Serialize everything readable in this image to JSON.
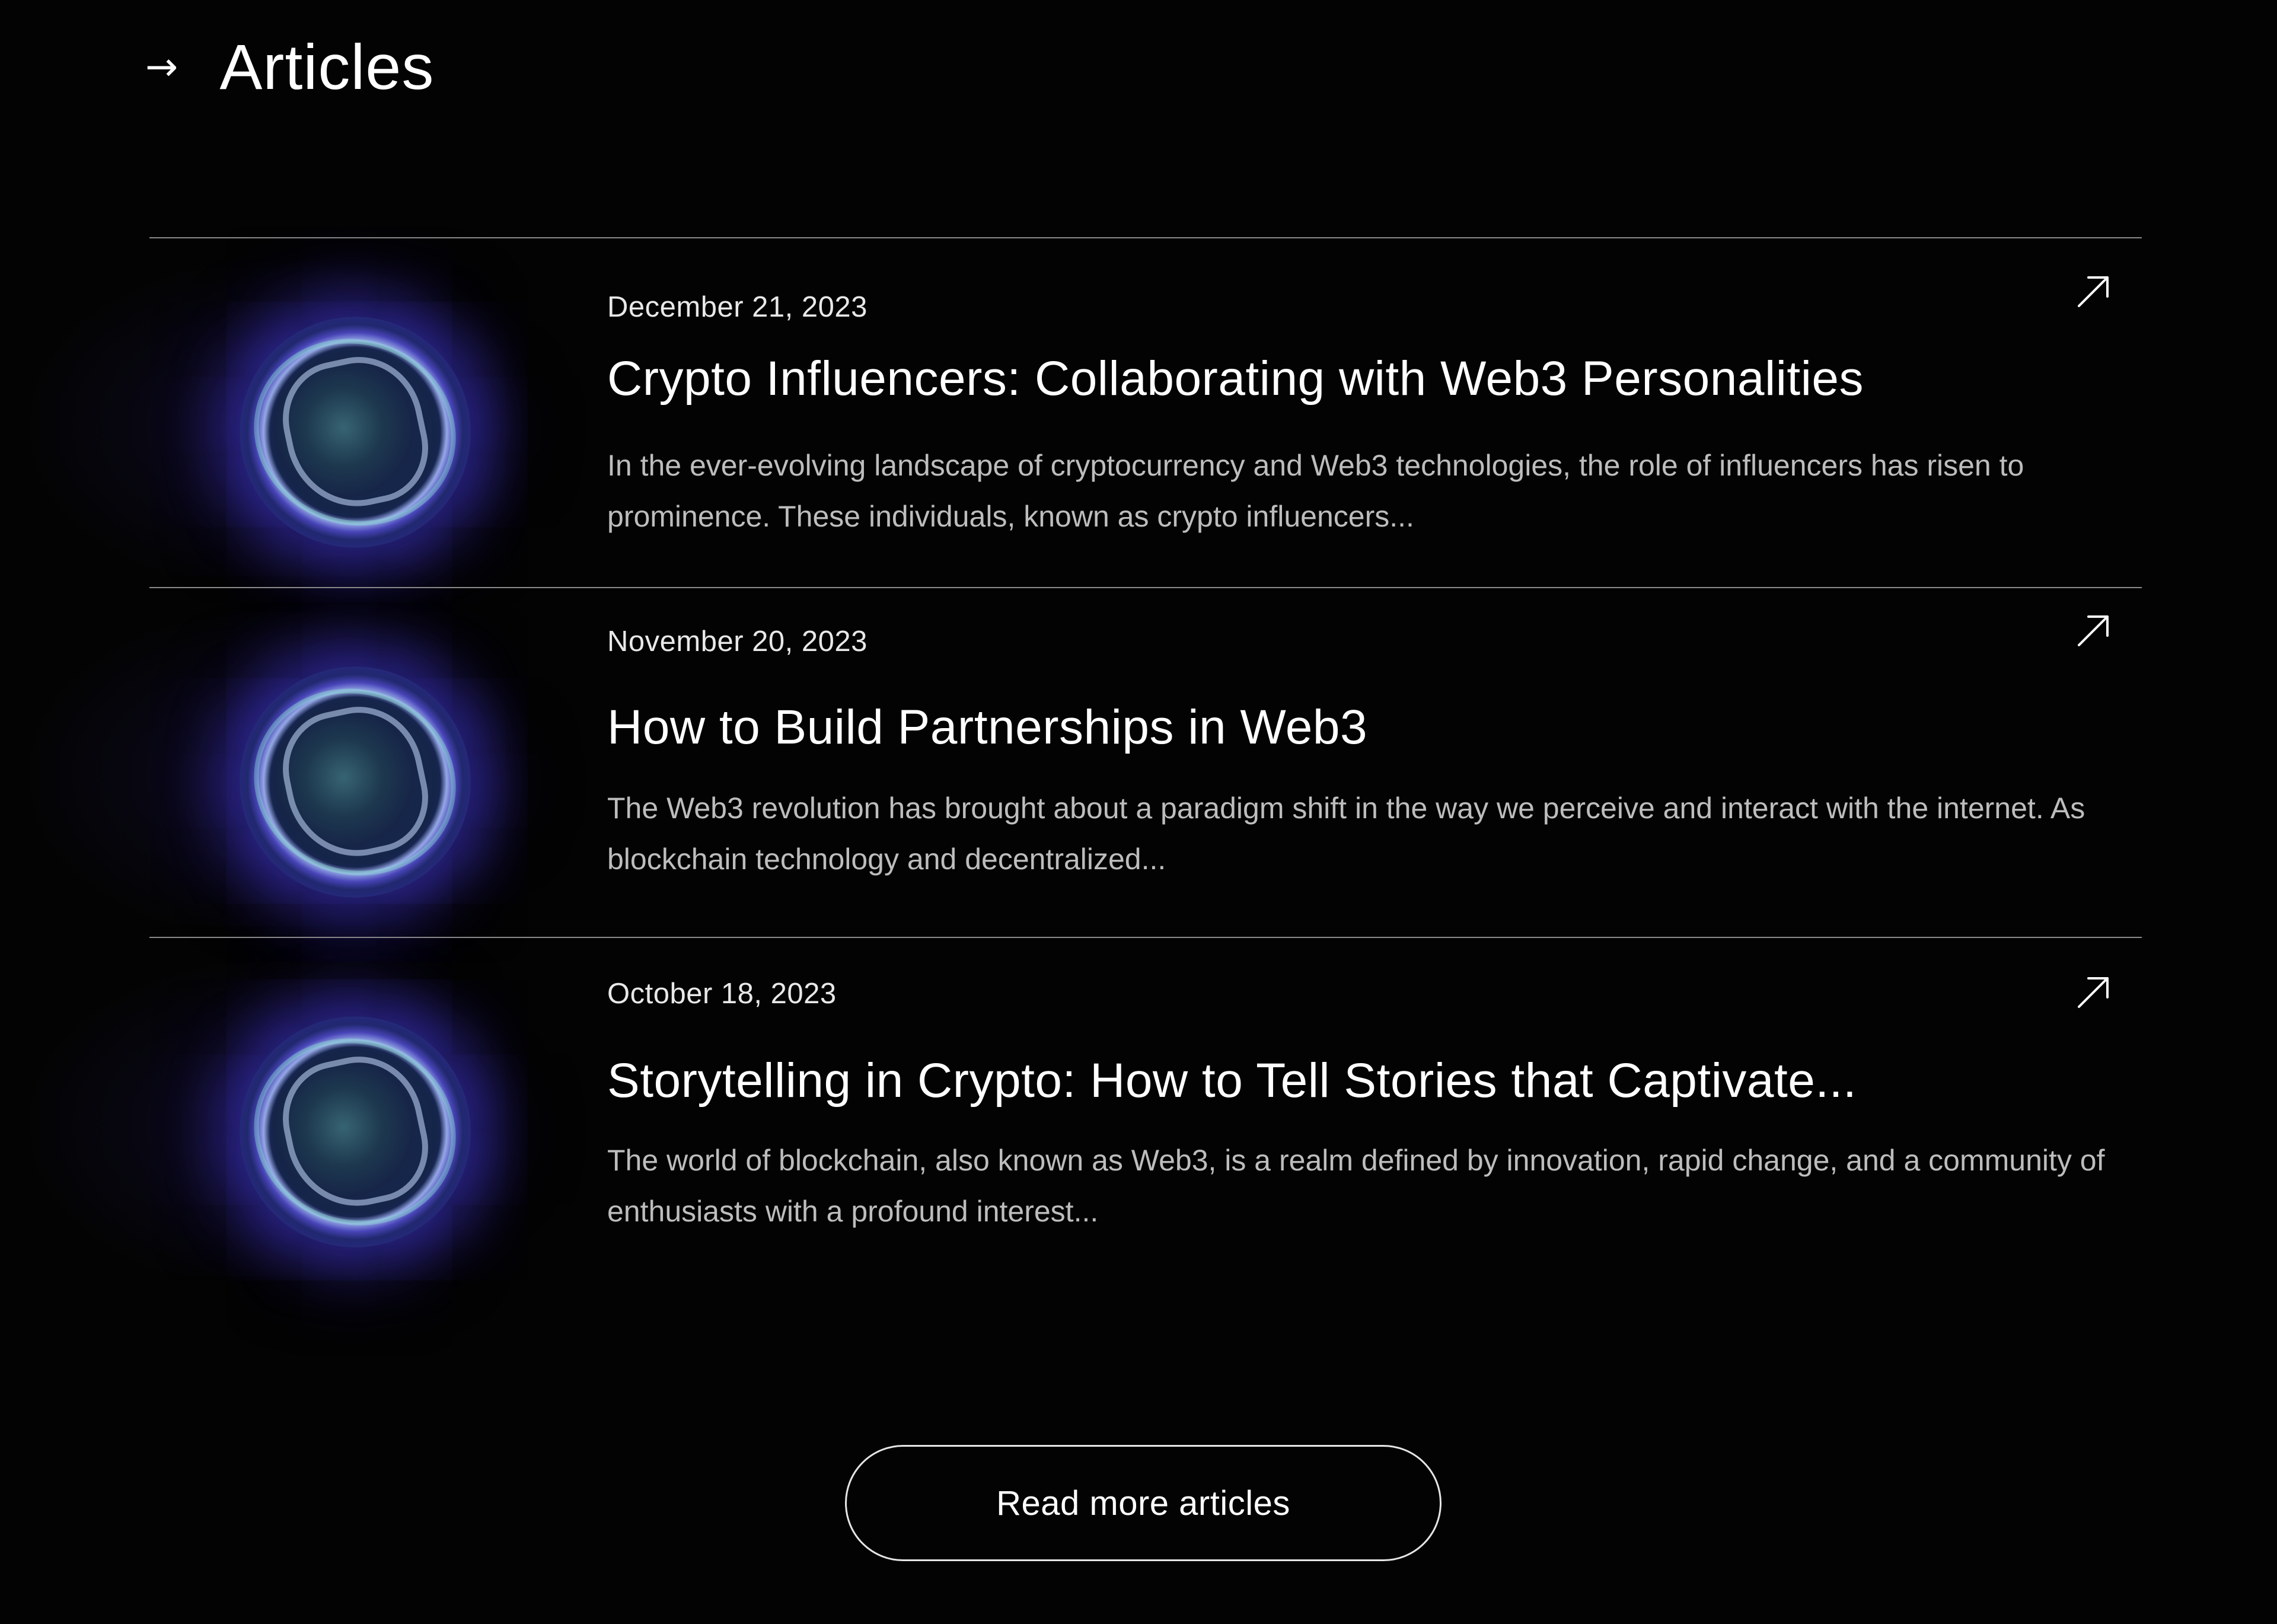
{
  "header": {
    "arrow_icon": "→",
    "title": "Articles"
  },
  "articles": [
    {
      "date": "December 21, 2023",
      "title": "Crypto Influencers: Collaborating with Web3 Personalities",
      "excerpt": "In the ever-evolving landscape of cryptocurrency and Web3 technologies, the role of influencers has risen to prominence. These individuals, known as crypto influencers...",
      "link_icon": "arrow-up-right-icon"
    },
    {
      "date": "November 20, 2023",
      "title": "How to Build Partnerships in Web3",
      "excerpt": "The Web3 revolution has brought about a paradigm shift in the way we perceive and interact with the internet. As blockchain technology and decentralized...",
      "link_icon": "arrow-up-right-icon"
    },
    {
      "date": "October 18, 2023",
      "title": "Storytelling in Crypto: How to Tell Stories that Captivate...",
      "excerpt": "The world of blockchain, also known as Web3, is a realm defined by innovation, rapid change, and a community of enthusiasts with a profound interest...",
      "link_icon": "arrow-up-right-icon"
    }
  ],
  "read_more_label": "Read more articles",
  "colors": {
    "background": "#030303",
    "text": "#ffffff",
    "muted_text": "#bdbdbd",
    "divider": "#8a8a8a",
    "orb_glow": "#5c5cff"
  }
}
